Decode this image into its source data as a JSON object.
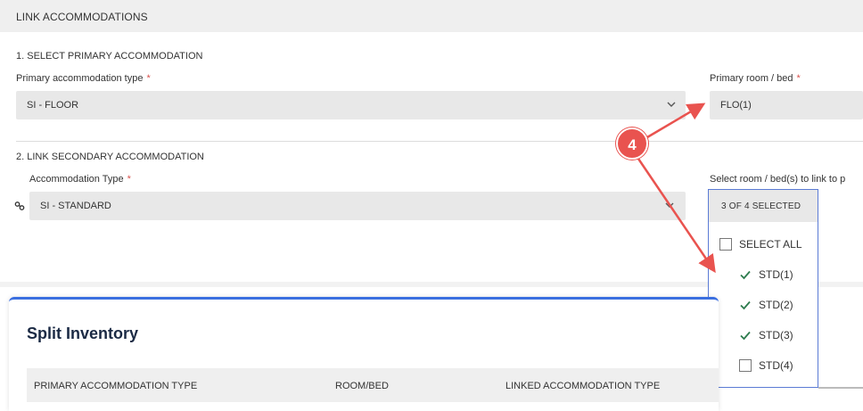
{
  "header": {
    "title": "LINK ACCOMMODATIONS"
  },
  "section1": {
    "title": "1. SELECT PRIMARY ACCOMMODATION",
    "primary_type_label": "Primary accommodation type",
    "primary_type_value": "SI - FLOOR",
    "primary_room_label": "Primary room / bed",
    "primary_room_value": "FLO(1)",
    "required_mark": "*"
  },
  "section2": {
    "title": "2. LINK SECONDARY ACCOMMODATION",
    "type_label": "Accommodation Type",
    "type_value": "SI - STANDARD",
    "rooms_label": "Select room / bed(s) to link to p",
    "rooms_summary": "3 OF 4 SELECTED",
    "select_all_label": "SELECT ALL",
    "options": [
      {
        "label": "STD(1)",
        "checked": true
      },
      {
        "label": "STD(2)",
        "checked": true
      },
      {
        "label": "STD(3)",
        "checked": true
      },
      {
        "label": "STD(4)",
        "checked": false
      }
    ]
  },
  "split_inventory": {
    "title": "Split Inventory",
    "columns": [
      "PRIMARY ACCOMMODATION TYPE",
      "ROOM/BED",
      "LINKED ACCOMMODATION TYPE"
    ]
  },
  "annotation": {
    "step": "4",
    "color": "#e9534f"
  },
  "icons": {
    "chevron": "chevron-down-icon",
    "link": "link-icon",
    "check": "check-icon"
  },
  "colors": {
    "accent_blue": "#3b6fe0",
    "highlight_yellow": "#f7f44f",
    "check_green": "#2e7d4f",
    "required_red": "#d9534f"
  }
}
